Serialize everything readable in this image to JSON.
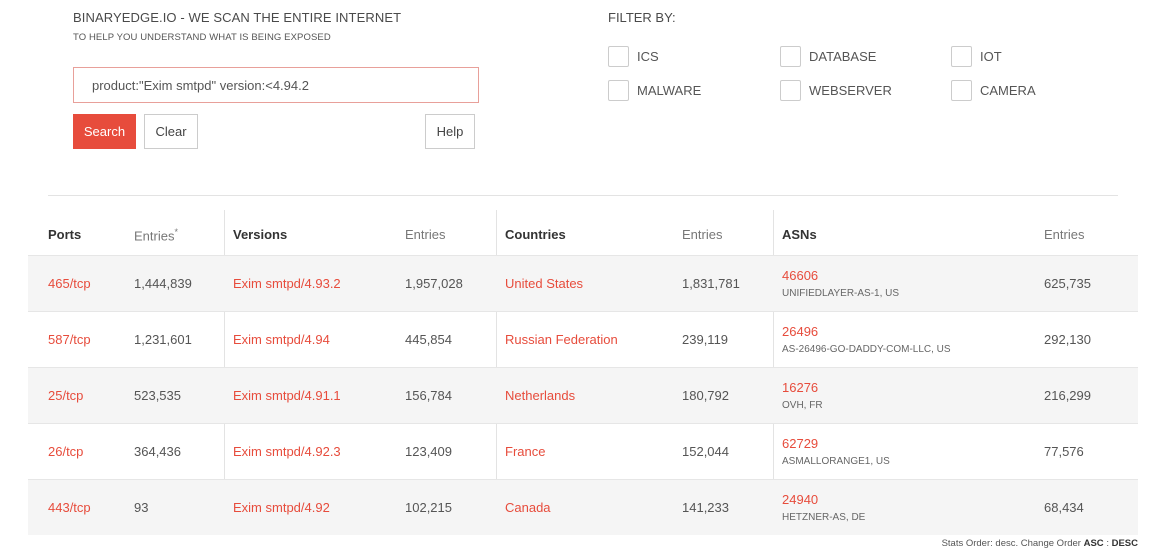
{
  "header": {
    "title": "BINARYEDGE.IO - WE SCAN THE ENTIRE INTERNET",
    "subtitle": "TO HELP YOU UNDERSTAND WHAT IS BEING EXPOSED"
  },
  "search": {
    "value": "product:\"Exim smtpd\" version:<4.94.2",
    "search_label": "Search",
    "clear_label": "Clear",
    "help_label": "Help"
  },
  "filters": {
    "title": "FILTER BY:",
    "items": [
      "ICS",
      "DATABASE",
      "IOT",
      "MALWARE",
      "WEBSERVER",
      "CAMERA"
    ]
  },
  "table": {
    "headers": {
      "ports": "Ports",
      "ports_entries": "Entries",
      "ports_entries_mark": "*",
      "versions": "Versions",
      "versions_entries": "Entries",
      "countries": "Countries",
      "countries_entries": "Entries",
      "asns": "ASNs",
      "asns_entries": "Entries"
    },
    "rows": [
      {
        "port": "465/tcp",
        "port_entries": "1,444,839",
        "version": "Exim smtpd/4.93.2",
        "version_entries": "1,957,028",
        "country": "United States",
        "country_entries": "1,831,781",
        "asn": "46606",
        "asn_name": "UNIFIEDLAYER-AS-1, US",
        "asn_entries": "625,735"
      },
      {
        "port": "587/tcp",
        "port_entries": "1,231,601",
        "version": "Exim smtpd/4.94",
        "version_entries": "445,854",
        "country": "Russian Federation",
        "country_entries": "239,119",
        "asn": "26496",
        "asn_name": "AS-26496-GO-DADDY-COM-LLC, US",
        "asn_entries": "292,130"
      },
      {
        "port": "25/tcp",
        "port_entries": "523,535",
        "version": "Exim smtpd/4.91.1",
        "version_entries": "156,784",
        "country": "Netherlands",
        "country_entries": "180,792",
        "asn": "16276",
        "asn_name": "OVH, FR",
        "asn_entries": "216,299"
      },
      {
        "port": "26/tcp",
        "port_entries": "364,436",
        "version": "Exim smtpd/4.92.3",
        "version_entries": "123,409",
        "country": "France",
        "country_entries": "152,044",
        "asn": "62729",
        "asn_name": "ASMALLORANGE1, US",
        "asn_entries": "77,576"
      },
      {
        "port": "443/tcp",
        "port_entries": "93",
        "version": "Exim smtpd/4.92",
        "version_entries": "102,215",
        "country": "Canada",
        "country_entries": "141,233",
        "asn": "24940",
        "asn_name": "HETZNER-AS, DE",
        "asn_entries": "68,434"
      }
    ]
  },
  "footer": {
    "text": "Stats Order: desc. Change Order",
    "asc": "ASC",
    "sep": ":",
    "desc": "DESC"
  },
  "colors": {
    "accent": "#e74c3c",
    "input_border": "#e8a09a",
    "row_alt": "#f5f5f5"
  }
}
